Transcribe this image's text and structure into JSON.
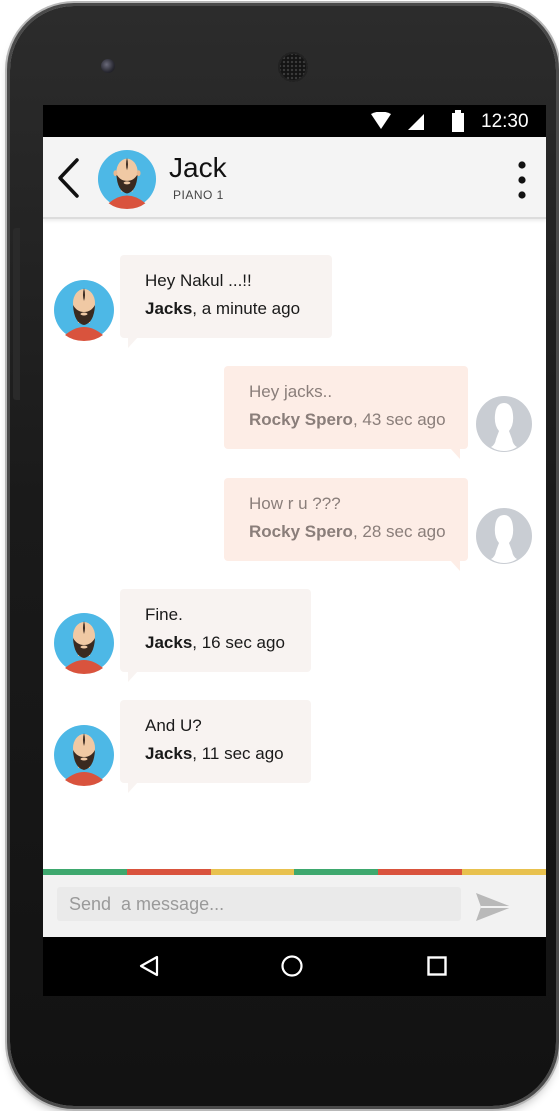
{
  "status_bar": {
    "time": "12:30",
    "icons": [
      "wifi-icon",
      "signal-icon",
      "battery-icon"
    ]
  },
  "header": {
    "back_icon": "chevron-left-icon",
    "contact_name": "Jack",
    "contact_subtitle": "PIANO 1",
    "menu_icon": "more-vertical-icon"
  },
  "messages": [
    {
      "direction": "incoming",
      "text": "Hey Nakul ...!!",
      "sender": "Jacks",
      "time": ", a minute ago"
    },
    {
      "direction": "outgoing",
      "text": "Hey jacks..",
      "sender": "Rocky Spero",
      "time": ", 43 sec ago"
    },
    {
      "direction": "outgoing",
      "text": "How r u ???",
      "sender": "Rocky Spero",
      "time": ", 28 sec ago"
    },
    {
      "direction": "incoming",
      "text": "Fine.",
      "sender": "Jacks",
      "time": ", 16 sec ago"
    },
    {
      "direction": "incoming",
      "text": "And U?",
      "sender": "Jacks",
      "time": ", 11 sec ago"
    }
  ],
  "composer": {
    "placeholder": "Send  a message...",
    "value": "",
    "send_icon": "send-icon"
  },
  "nav_bar": {
    "icons": [
      "nav-back-icon",
      "nav-home-icon",
      "nav-recents-icon"
    ]
  },
  "colors": {
    "strip": [
      "#3ea86e",
      "#d9533d",
      "#e8c14e",
      "#3ea86e",
      "#d9533d",
      "#e8c14e"
    ],
    "incoming_bubble": "#f8f3f1",
    "outgoing_bubble": "#fdede6",
    "avatar_bg": "#4db8e6"
  }
}
